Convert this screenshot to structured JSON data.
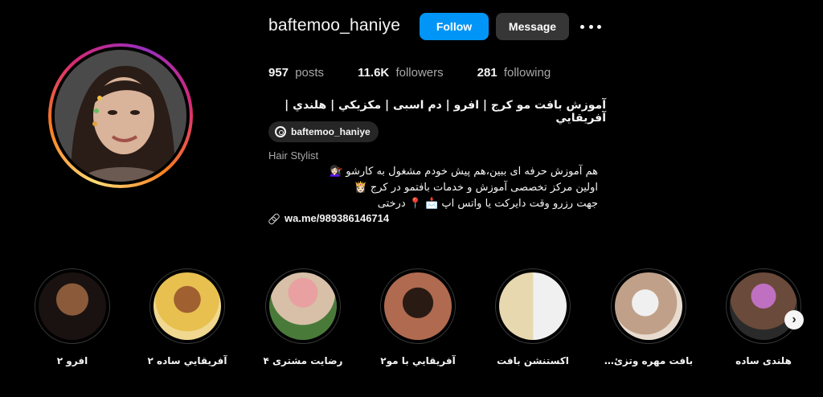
{
  "profile": {
    "username": "baftemoo_haniye",
    "follow_label": "Follow",
    "message_label": "Message",
    "posts_count": "957",
    "posts_label": "posts",
    "followers_count": "11.6K",
    "followers_label": "followers",
    "following_count": "281",
    "following_label": "following",
    "full_name": "آموزش بافت مو کرج | افرو | دم اسبی | مکزیکي | هلندي | آفريقايي",
    "threads_handle": "baftemoo_haniye",
    "category": "Hair Stylist",
    "bio": [
      "هم آموزش حرفه ای ببین،هم پیش خودم مشغول به کارشو 💇🏻‍♀️",
      "اولین مرکز تخصصی آموزش و خدمات بافتمو در کرج 👸🏻",
      "جهت رزرو وقت دایرکت یا واتس اپ 📩 📍 درختی"
    ],
    "link": "wa.me/989386146714"
  },
  "highlights": [
    {
      "label": "افرو ۲",
      "color": "#5a3a28"
    },
    {
      "label": "آفريقايي ساده ۲",
      "color": "#d9a23a"
    },
    {
      "label": "رضایت مشتری ۴",
      "color": "#c98a8a"
    },
    {
      "label": "آفريقايي با مو۲",
      "color": "#7a4a3a"
    },
    {
      "label": "اکستنشن بافت",
      "color": "#c8c0b4"
    },
    {
      "label": "بافت مهره وتزئ…",
      "color": "#b89a80"
    },
    {
      "label": "هلندی ساده",
      "color": "#6a4a5a"
    }
  ],
  "icons": {
    "more": "more-options-icon",
    "threads": "threads-icon",
    "link": "link-icon",
    "next": "chevron-right-icon"
  },
  "colors": {
    "follow_button": "#0095f6",
    "message_button": "#363636",
    "background": "#000000"
  }
}
